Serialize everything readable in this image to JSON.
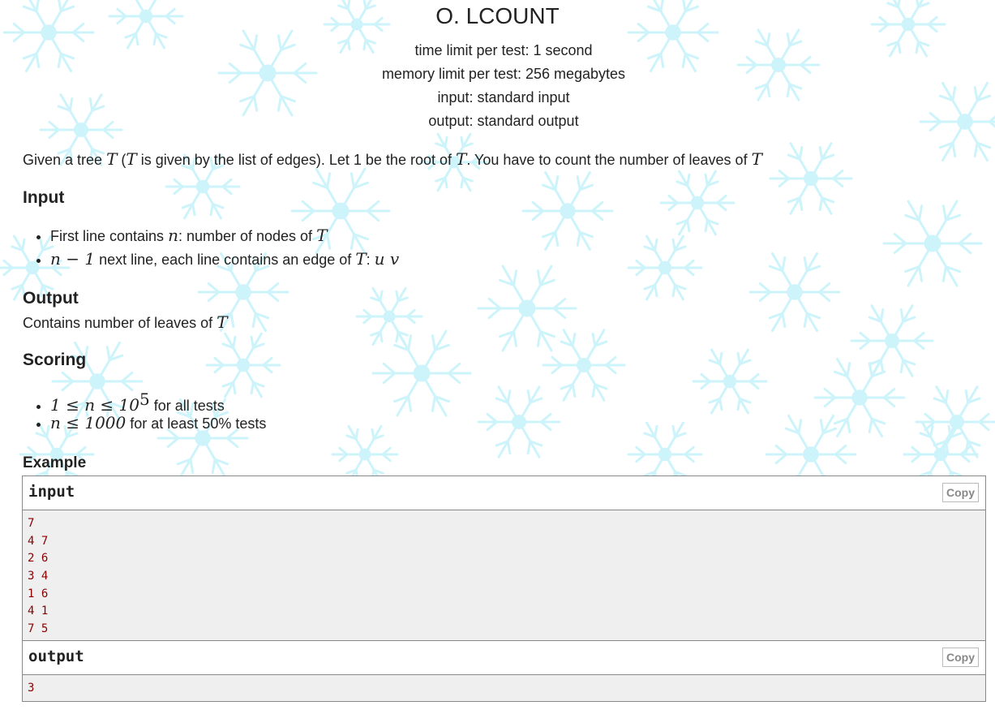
{
  "problem": {
    "title": "O. LCOUNT",
    "time_limit": "time limit per test: 1 second",
    "memory_limit": "memory limit per test: 256 megabytes",
    "input_type": "input: standard input",
    "output_type": "output: standard output"
  },
  "statement": {
    "t1": "Given a tree ",
    "m1": "T",
    "t2": " (",
    "m2": "T",
    "t3": " is given by the list of edges). Let 1 be the root of ",
    "m3": "T",
    "t4": ". You have to count the number of leaves of ",
    "m4": "T"
  },
  "input_section": {
    "title": "Input",
    "line1": {
      "t1": "First line contains ",
      "m1": "n",
      "t2": ": number of nodes of ",
      "m2": "T"
    },
    "line2": {
      "m1": "n − 1",
      "t1": " next line, each line contains an edge of ",
      "m2": "T",
      "t2": ": ",
      "m3": "u v"
    }
  },
  "output_section": {
    "title": "Output",
    "t1": "Contains number of leaves of ",
    "m1": "T"
  },
  "scoring": {
    "title": "Scoring",
    "line1": {
      "m1": "1 ≤ n ≤ 10",
      "sup": "5",
      "t1": " for all tests"
    },
    "line2": {
      "m1": "n ≤ 1000",
      "t1": " for at least 50% tests"
    }
  },
  "example": {
    "title": "Example",
    "input_label": "input",
    "output_label": "output",
    "copy_label": "Copy",
    "input_lines": [
      "7",
      "4 7",
      "2 6",
      "3 4",
      "1 6",
      "4 1",
      "7 5"
    ],
    "output_lines": [
      "3"
    ]
  },
  "colors": {
    "snowflake": "#cdf4fa",
    "sample_text": "#8b0000",
    "sample_bg": "#efefef"
  }
}
